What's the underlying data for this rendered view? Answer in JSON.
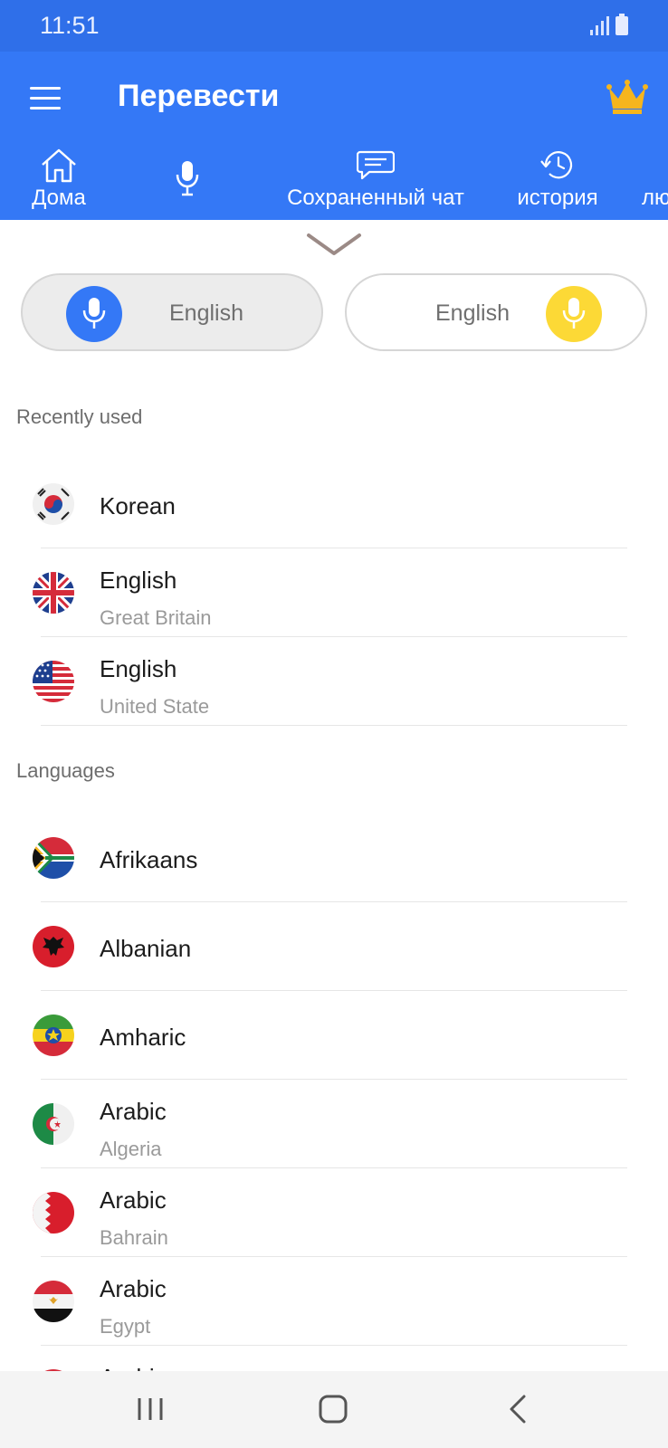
{
  "status_bar": {
    "time": "11:51"
  },
  "app_bar": {
    "title": "Перевести",
    "tabs": [
      {
        "label": "Дома",
        "icon": "home-icon"
      },
      {
        "label": "",
        "icon": "mic-icon",
        "selected": true
      },
      {
        "label": "Сохраненный чат",
        "icon": "chat-icon"
      },
      {
        "label": "история",
        "icon": "history-icon"
      },
      {
        "label": "лю",
        "icon": ""
      }
    ]
  },
  "language_selector": {
    "source": {
      "label": "English",
      "color": "#3478f6"
    },
    "target": {
      "label": "English",
      "color": "#fcd936"
    }
  },
  "recent": {
    "title": "Recently used",
    "items": [
      {
        "name": "Korean",
        "sub": "",
        "flag": "korea-flag-icon"
      },
      {
        "name": "English",
        "sub": "Great Britain",
        "flag": "uk-flag-icon"
      },
      {
        "name": "English",
        "sub": "United State",
        "flag": "us-flag-icon"
      }
    ]
  },
  "languages": {
    "title": "Languages",
    "items": [
      {
        "name": "Afrikaans",
        "sub": "",
        "flag": "south-africa-flag-icon"
      },
      {
        "name": "Albanian",
        "sub": "",
        "flag": "albania-flag-icon"
      },
      {
        "name": "Amharic",
        "sub": "",
        "flag": "ethiopia-flag-icon"
      },
      {
        "name": "Arabic",
        "sub": "Algeria",
        "flag": "algeria-flag-icon"
      },
      {
        "name": "Arabic",
        "sub": "Bahrain",
        "flag": "bahrain-flag-icon"
      },
      {
        "name": "Arabic",
        "sub": "Egypt",
        "flag": "egypt-flag-icon"
      },
      {
        "name": "Arabic",
        "sub": "",
        "flag": ""
      }
    ]
  },
  "colors": {
    "primary": "#3478f6",
    "status_bar": "#2f6fe9",
    "accent": "#fcd936"
  }
}
